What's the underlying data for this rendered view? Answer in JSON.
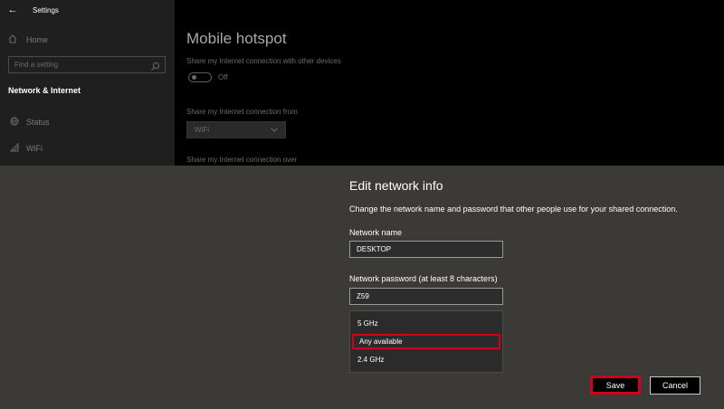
{
  "window": {
    "title": "Settings",
    "back_icon": "back-arrow-icon"
  },
  "sidebar": {
    "home_label": "Home",
    "search_placeholder": "Find a setting",
    "section_title": "Network & Internet",
    "items": [
      {
        "label": "Status",
        "icon": "status-globe-icon"
      },
      {
        "label": "WiFi",
        "icon": "wifi-icon"
      }
    ]
  },
  "main": {
    "title": "Mobile hotspot",
    "share_label": "Share my Internet connection with other devices",
    "toggle_state": "Off",
    "share_from_label": "Share my Internet connection from",
    "share_from_value": "WiFi",
    "share_over_label": "Share my Internet connection over"
  },
  "dialog": {
    "title": "Edit network info",
    "description": "Change the network name and password that other people use for your shared connection.",
    "name_label": "Network name",
    "name_value": "DESKTOP",
    "password_label": "Network password (at least 8 characters)",
    "password_value": "Z59",
    "band_options": [
      "5 GHz",
      "Any available",
      "2.4 GHz"
    ],
    "selected_band": "Any available",
    "save_label": "Save",
    "cancel_label": "Cancel"
  },
  "colors": {
    "highlight": "#d0021b",
    "overlay": "#3b3a37",
    "sidebar_bg": "#1f1f1f"
  }
}
